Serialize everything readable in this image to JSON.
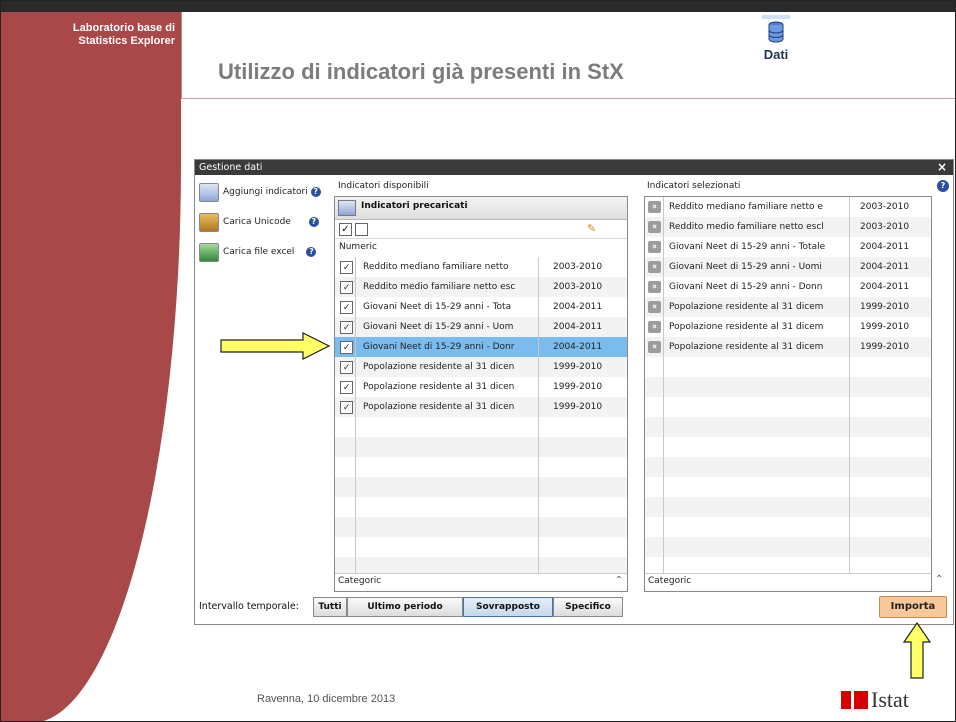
{
  "slide": {
    "sidebar_title_line1": "Laboratorio base  di",
    "sidebar_title_line2": "Statistics Explorer",
    "title": "Utilizzo di indicatori già presenti in StX",
    "dati_label": "Dati",
    "footer": "Ravenna, 10 dicembre 2013",
    "logo_text": "Istat"
  },
  "window": {
    "title": "Gestione dati",
    "close": "×",
    "actions": [
      {
        "label": "Aggiungi indicatori",
        "icon": "folder-icon"
      },
      {
        "label": "Carica Unicode",
        "icon": "unicode-icon"
      },
      {
        "label": "Carica file excel",
        "icon": "excel-icon"
      }
    ],
    "available": {
      "label": "Indicatori disponibili",
      "folder_label": "Indicatori precaricati",
      "group_numeric": "Numeric",
      "group_categoric": "Categoric",
      "rows": [
        {
          "name": "Reddito mediano familiare netto",
          "years": "2003-2010",
          "checked": true
        },
        {
          "name": "Reddito medio familiare netto esc",
          "years": "2003-2010",
          "checked": true
        },
        {
          "name": "Giovani Neet di 15-29 anni - Tota",
          "years": "2004-2011",
          "checked": true
        },
        {
          "name": "Giovani Neet di 15-29 anni - Uom",
          "years": "2004-2011",
          "checked": true
        },
        {
          "name": "Giovani Neet di 15-29 anni - Donr",
          "years": "2004-2011",
          "checked": true
        },
        {
          "name": "Popolazione residente al 31 dicen",
          "years": "1999-2010",
          "checked": true
        },
        {
          "name": "Popolazione residente al 31 dicen",
          "years": "1999-2010",
          "checked": true
        },
        {
          "name": "Popolazione residente al 31 dicen",
          "years": "1999-2010",
          "checked": true
        }
      ]
    },
    "selected": {
      "label": "Indicatori selezionati",
      "group_categoric": "Categoric",
      "rows": [
        {
          "name": "Reddito mediano familiare netto e",
          "years": "2003-2010"
        },
        {
          "name": "Reddito medio familiare netto escl",
          "years": "2003-2010"
        },
        {
          "name": "Giovani Neet di 15-29 anni - Totale",
          "years": "2004-2011"
        },
        {
          "name": "Giovani Neet di 15-29 anni - Uomi",
          "years": "2004-2011"
        },
        {
          "name": "Giovani Neet di 15-29 anni - Donn",
          "years": "2004-2011"
        },
        {
          "name": "Popolazione residente al 31 dicem",
          "years": "1999-2010"
        },
        {
          "name": "Popolazione residente al 31 dicem",
          "years": "1999-2010"
        },
        {
          "name": "Popolazione residente al 31 dicem",
          "years": "1999-2010"
        }
      ]
    },
    "interval_label": "Intervallo temporale:",
    "interval_options": [
      "Tutti",
      "Ultimo periodo",
      "Sovrapposto",
      "Specifico"
    ],
    "interval_selected": "Sovrapposto",
    "import_label": "Importa"
  },
  "colors": {
    "sidebar": "#a84848",
    "selected_row": "#7bbcee",
    "arrow_fill": "#ffff66",
    "import_button": "#f8c89a"
  }
}
